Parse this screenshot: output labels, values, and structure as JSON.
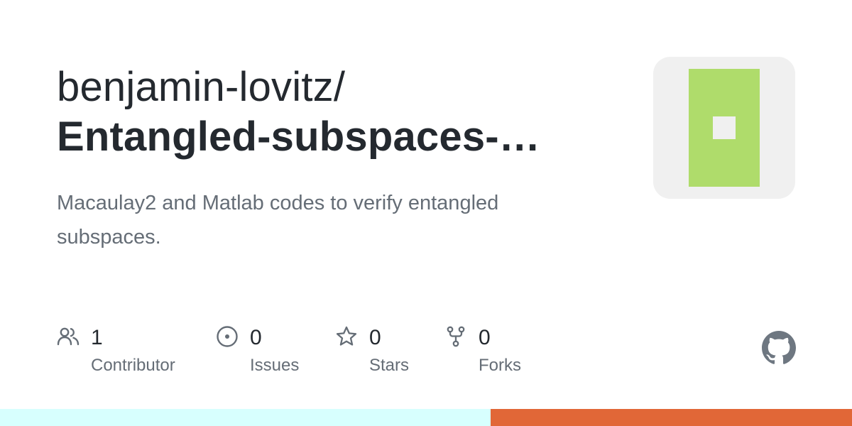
{
  "repo": {
    "owner": "benjamin-lovitz/",
    "name": "Entangled-subspaces-…",
    "description": "Macaulay2 and Matlab codes to verify entangled subspaces."
  },
  "avatar": {
    "background": "#f0f0f0",
    "identicon_color": "#afdc6b",
    "inner_color": "#f0f0f0"
  },
  "stats": [
    {
      "icon": "people-icon",
      "count": "1",
      "label": "Contributor"
    },
    {
      "icon": "issue-opened-icon",
      "count": "0",
      "label": "Issues"
    },
    {
      "icon": "star-icon",
      "count": "0",
      "label": "Stars"
    },
    {
      "icon": "repo-forked-icon",
      "count": "0",
      "label": "Forks"
    }
  ],
  "github_logo": {
    "icon": "github-mark-icon",
    "color": "#6e7781"
  },
  "languages": [
    {
      "color": "#d7fffe",
      "share": 0.576
    },
    {
      "color": "#e16737",
      "share": 0.424
    }
  ]
}
